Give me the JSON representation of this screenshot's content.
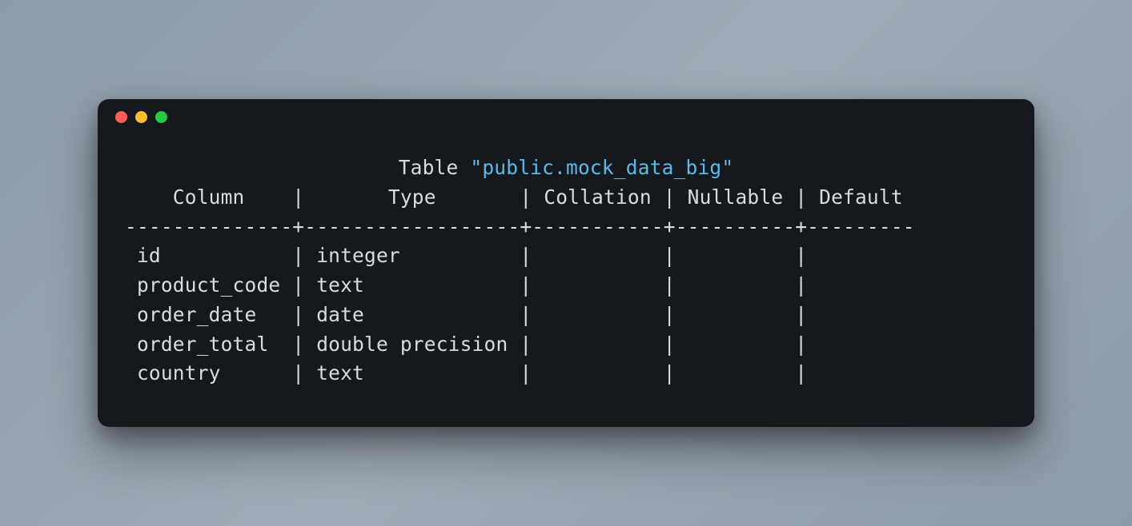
{
  "title": {
    "label": "Table",
    "quoted_name": "\"public.mock_data_big\""
  },
  "headers": {
    "col1": "Column",
    "col2": "Type",
    "col3": "Collation",
    "col4": "Nullable",
    "col5": "Default"
  },
  "divider": "--------------+------------------+-----------+----------+---------",
  "rows": [
    {
      "column": "id",
      "type": "integer",
      "collation": "",
      "nullable": "",
      "default": ""
    },
    {
      "column": "product_code",
      "type": "text",
      "collation": "",
      "nullable": "",
      "default": ""
    },
    {
      "column": "order_date",
      "type": "date",
      "collation": "",
      "nullable": "",
      "default": ""
    },
    {
      "column": "order_total",
      "type": "double precision",
      "collation": "",
      "nullable": "",
      "default": ""
    },
    {
      "column": "country",
      "type": "text",
      "collation": "",
      "nullable": "",
      "default": ""
    }
  ]
}
